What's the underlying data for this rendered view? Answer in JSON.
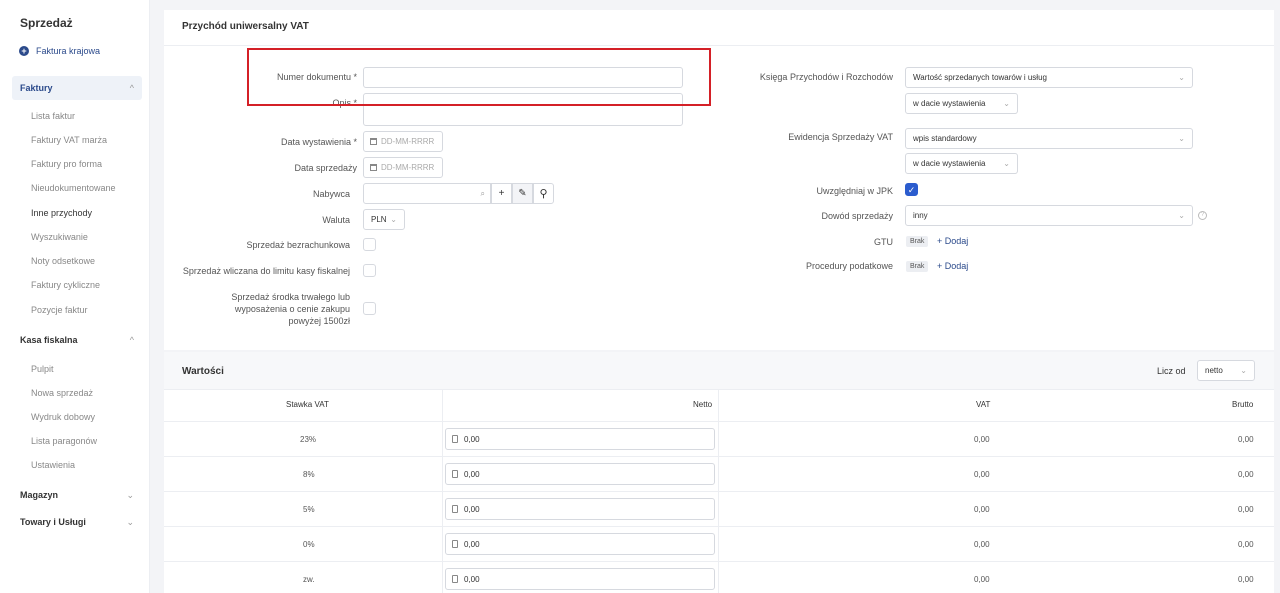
{
  "sidebar": {
    "title": "Sprzedaż",
    "new_invoice": "Faktura krajowa",
    "sections": [
      {
        "label": "Faktury",
        "chevron": "^"
      },
      {
        "label": "Kasa fiskalna",
        "chevron": "^"
      },
      {
        "label": "Magazyn",
        "chevron": "v"
      },
      {
        "label": "Towary i Usługi",
        "chevron": "v"
      }
    ],
    "faktury_items": [
      "Lista faktur",
      "Faktury VAT marża",
      "Faktury pro forma",
      "Nieudokumentowane",
      "Inne przychody",
      "Wyszukiwanie",
      "Noty odsetkowe",
      "Faktury cykliczne",
      "Pozycje faktur"
    ],
    "kasa_items": [
      "Pulpit",
      "Nowa sprzedaż",
      "Wydruk dobowy",
      "Lista paragonów",
      "Ustawienia"
    ]
  },
  "form": {
    "title": "Przychód uniwersalny VAT",
    "labels": {
      "numer": "Numer dokumentu *",
      "opis": "Opis *",
      "data_wyst": "Data wystawienia *",
      "data_sprz": "Data sprzedaży",
      "nabywca": "Nabywca",
      "waluta": "Waluta",
      "bezrach": "Sprzedaż bezrachunkowa",
      "limit": "Sprzedaż wliczana do limitu kasy fiskalnej",
      "srodek": "Sprzedaż środka trwałego lub wyposażenia o cenie zakupu powyżej 1500zł"
    },
    "date_placeholder": "DD-MM-RRRR",
    "waluta_value": "PLN",
    "right": {
      "ksiega_label": "Księga Przychodów i Rozchodów",
      "ksiega_value": "Wartość sprzedanych towarów i usług",
      "ksiega_date": "w dacie wystawienia",
      "ewid_label": "Ewidencja Sprzedaży VAT",
      "ewid_value": "wpis standardowy",
      "ewid_date": "w dacie wystawienia",
      "jpk_label": "Uwzględniaj w JPK",
      "dowod_label": "Dowód sprzedaży",
      "dowod_value": "inny",
      "gtu_label": "GTU",
      "proc_label": "Procedury podatkowe",
      "badge": "Brak",
      "add": "+ Dodaj"
    }
  },
  "values": {
    "title": "Wartości",
    "licz_od_label": "Licz od",
    "licz_od_value": "netto",
    "columns": [
      "Stawka VAT",
      "Netto",
      "VAT",
      "Brutto"
    ],
    "rows": [
      {
        "rate": "23%",
        "netto": "0,00",
        "vat": "0,00",
        "brutto": "0,00"
      },
      {
        "rate": "8%",
        "netto": "0,00",
        "vat": "0,00",
        "brutto": "0,00"
      },
      {
        "rate": "5%",
        "netto": "0,00",
        "vat": "0,00",
        "brutto": "0,00"
      },
      {
        "rate": "0%",
        "netto": "0,00",
        "vat": "0,00",
        "brutto": "0,00"
      },
      {
        "rate": "zw.",
        "netto": "0,00",
        "vat": "0,00",
        "brutto": "0,00"
      }
    ]
  }
}
